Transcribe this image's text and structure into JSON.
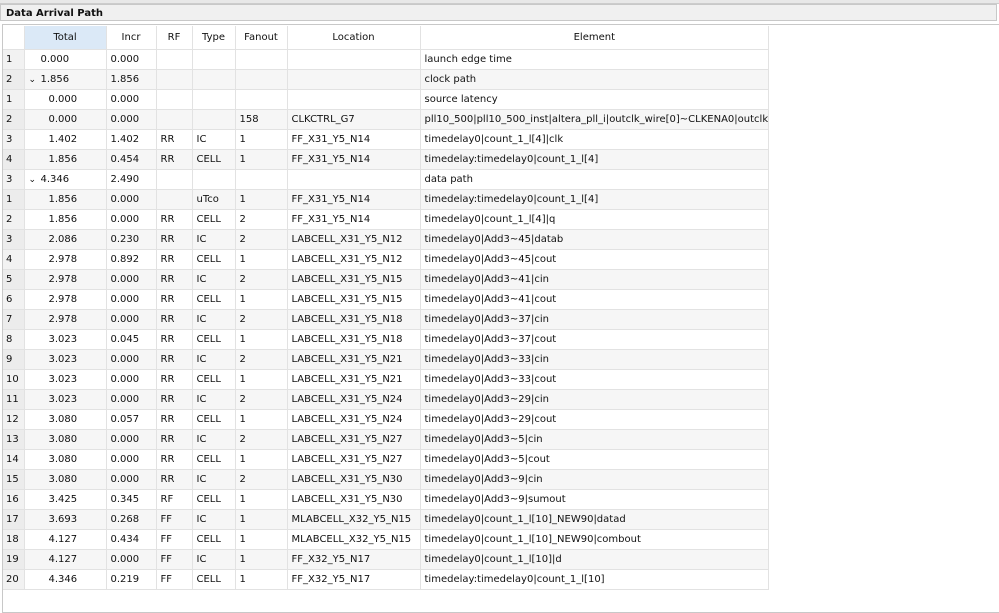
{
  "panel_title": "Data Arrival Path",
  "columns": [
    "",
    "Total",
    "Incr",
    "RF",
    "Type",
    "Fanout",
    "Location",
    "Element"
  ],
  "rows": [
    {
      "n": "1",
      "level": 0,
      "expand": false,
      "total": "0.000",
      "incr": "0.000",
      "rf": "",
      "type": "",
      "fanout": "",
      "location": "",
      "element": "launch edge time"
    },
    {
      "n": "2",
      "level": 0,
      "expand": true,
      "total": "1.856",
      "incr": "1.856",
      "rf": "",
      "type": "",
      "fanout": "",
      "location": "",
      "element": "clock path"
    },
    {
      "n": "1",
      "level": 1,
      "expand": false,
      "total": "0.000",
      "incr": "0.000",
      "rf": "",
      "type": "",
      "fanout": "",
      "location": "",
      "element": "source latency"
    },
    {
      "n": "2",
      "level": 1,
      "expand": false,
      "total": "0.000",
      "incr": "0.000",
      "rf": "",
      "type": "",
      "fanout": "158",
      "location": "CLKCTRL_G7",
      "element": "pll10_500|pll10_500_inst|altera_pll_i|outclk_wire[0]~CLKENA0|outclk"
    },
    {
      "n": "3",
      "level": 1,
      "expand": false,
      "total": "1.402",
      "incr": "1.402",
      "rf": "RR",
      "type": "IC",
      "fanout": "1",
      "location": "FF_X31_Y5_N14",
      "element": "timedelay0|count_1_l[4]|clk"
    },
    {
      "n": "4",
      "level": 1,
      "expand": false,
      "total": "1.856",
      "incr": "0.454",
      "rf": "RR",
      "type": "CELL",
      "fanout": "1",
      "location": "FF_X31_Y5_N14",
      "element": "timedelay:timedelay0|count_1_l[4]"
    },
    {
      "n": "3",
      "level": 0,
      "expand": true,
      "total": "4.346",
      "incr": "2.490",
      "rf": "",
      "type": "",
      "fanout": "",
      "location": "",
      "element": "data path"
    },
    {
      "n": "1",
      "level": 1,
      "expand": false,
      "total": "1.856",
      "incr": "0.000",
      "rf": "",
      "type": "uTco",
      "fanout": "1",
      "location": "FF_X31_Y5_N14",
      "element": "timedelay:timedelay0|count_1_l[4]"
    },
    {
      "n": "2",
      "level": 1,
      "expand": false,
      "total": "1.856",
      "incr": "0.000",
      "rf": "RR",
      "type": "CELL",
      "fanout": "2",
      "location": "FF_X31_Y5_N14",
      "element": "timedelay0|count_1_l[4]|q"
    },
    {
      "n": "3",
      "level": 1,
      "expand": false,
      "total": "2.086",
      "incr": "0.230",
      "rf": "RR",
      "type": "IC",
      "fanout": "2",
      "location": "LABCELL_X31_Y5_N12",
      "element": "timedelay0|Add3~45|datab"
    },
    {
      "n": "4",
      "level": 1,
      "expand": false,
      "total": "2.978",
      "incr": "0.892",
      "rf": "RR",
      "type": "CELL",
      "fanout": "1",
      "location": "LABCELL_X31_Y5_N12",
      "element": "timedelay0|Add3~45|cout"
    },
    {
      "n": "5",
      "level": 1,
      "expand": false,
      "total": "2.978",
      "incr": "0.000",
      "rf": "RR",
      "type": "IC",
      "fanout": "2",
      "location": "LABCELL_X31_Y5_N15",
      "element": "timedelay0|Add3~41|cin"
    },
    {
      "n": "6",
      "level": 1,
      "expand": false,
      "total": "2.978",
      "incr": "0.000",
      "rf": "RR",
      "type": "CELL",
      "fanout": "1",
      "location": "LABCELL_X31_Y5_N15",
      "element": "timedelay0|Add3~41|cout"
    },
    {
      "n": "7",
      "level": 1,
      "expand": false,
      "total": "2.978",
      "incr": "0.000",
      "rf": "RR",
      "type": "IC",
      "fanout": "2",
      "location": "LABCELL_X31_Y5_N18",
      "element": "timedelay0|Add3~37|cin"
    },
    {
      "n": "8",
      "level": 1,
      "expand": false,
      "total": "3.023",
      "incr": "0.045",
      "rf": "RR",
      "type": "CELL",
      "fanout": "1",
      "location": "LABCELL_X31_Y5_N18",
      "element": "timedelay0|Add3~37|cout"
    },
    {
      "n": "9",
      "level": 1,
      "expand": false,
      "total": "3.023",
      "incr": "0.000",
      "rf": "RR",
      "type": "IC",
      "fanout": "2",
      "location": "LABCELL_X31_Y5_N21",
      "element": "timedelay0|Add3~33|cin"
    },
    {
      "n": "10",
      "level": 1,
      "expand": false,
      "total": "3.023",
      "incr": "0.000",
      "rf": "RR",
      "type": "CELL",
      "fanout": "1",
      "location": "LABCELL_X31_Y5_N21",
      "element": "timedelay0|Add3~33|cout"
    },
    {
      "n": "11",
      "level": 1,
      "expand": false,
      "total": "3.023",
      "incr": "0.000",
      "rf": "RR",
      "type": "IC",
      "fanout": "2",
      "location": "LABCELL_X31_Y5_N24",
      "element": "timedelay0|Add3~29|cin"
    },
    {
      "n": "12",
      "level": 1,
      "expand": false,
      "total": "3.080",
      "incr": "0.057",
      "rf": "RR",
      "type": "CELL",
      "fanout": "1",
      "location": "LABCELL_X31_Y5_N24",
      "element": "timedelay0|Add3~29|cout"
    },
    {
      "n": "13",
      "level": 1,
      "expand": false,
      "total": "3.080",
      "incr": "0.000",
      "rf": "RR",
      "type": "IC",
      "fanout": "2",
      "location": "LABCELL_X31_Y5_N27",
      "element": "timedelay0|Add3~5|cin"
    },
    {
      "n": "14",
      "level": 1,
      "expand": false,
      "total": "3.080",
      "incr": "0.000",
      "rf": "RR",
      "type": "CELL",
      "fanout": "1",
      "location": "LABCELL_X31_Y5_N27",
      "element": "timedelay0|Add3~5|cout"
    },
    {
      "n": "15",
      "level": 1,
      "expand": false,
      "total": "3.080",
      "incr": "0.000",
      "rf": "RR",
      "type": "IC",
      "fanout": "2",
      "location": "LABCELL_X31_Y5_N30",
      "element": "timedelay0|Add3~9|cin"
    },
    {
      "n": "16",
      "level": 1,
      "expand": false,
      "total": "3.425",
      "incr": "0.345",
      "rf": "RF",
      "type": "CELL",
      "fanout": "1",
      "location": "LABCELL_X31_Y5_N30",
      "element": "timedelay0|Add3~9|sumout"
    },
    {
      "n": "17",
      "level": 1,
      "expand": false,
      "total": "3.693",
      "incr": "0.268",
      "rf": "FF",
      "type": "IC",
      "fanout": "1",
      "location": "MLABCELL_X32_Y5_N15",
      "element": "timedelay0|count_1_l[10]_NEW90|datad"
    },
    {
      "n": "18",
      "level": 1,
      "expand": false,
      "total": "4.127",
      "incr": "0.434",
      "rf": "FF",
      "type": "CELL",
      "fanout": "1",
      "location": "MLABCELL_X32_Y5_N15",
      "element": "timedelay0|count_1_l[10]_NEW90|combout"
    },
    {
      "n": "19",
      "level": 1,
      "expand": false,
      "total": "4.127",
      "incr": "0.000",
      "rf": "FF",
      "type": "IC",
      "fanout": "1",
      "location": "FF_X32_Y5_N17",
      "element": "timedelay0|count_1_l[10]|d"
    },
    {
      "n": "20",
      "level": 1,
      "expand": false,
      "total": "4.346",
      "incr": "0.219",
      "rf": "FF",
      "type": "CELL",
      "fanout": "1",
      "location": "FF_X32_Y5_N17",
      "element": "timedelay:timedelay0|count_1_l[10]"
    }
  ]
}
